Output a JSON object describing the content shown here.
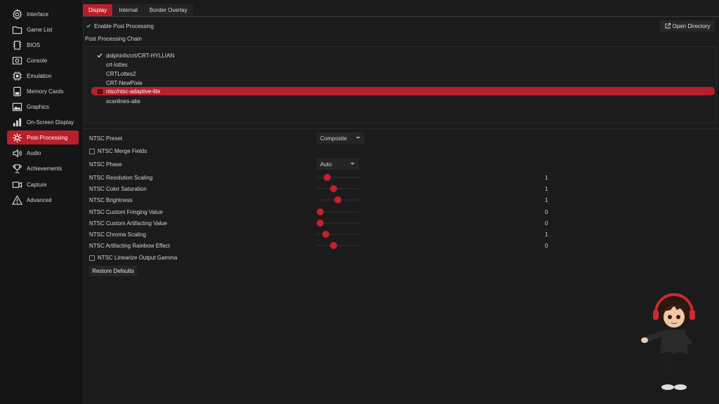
{
  "sidebar": {
    "items": [
      {
        "label": "Interface",
        "icon": "gear-icon"
      },
      {
        "label": "Game List",
        "icon": "folder-icon"
      },
      {
        "label": "BIOS",
        "icon": "chip-icon"
      },
      {
        "label": "Console",
        "icon": "console-icon"
      },
      {
        "label": "Emulation",
        "icon": "cpu-icon"
      },
      {
        "label": "Memory Cards",
        "icon": "memory-card-icon"
      },
      {
        "label": "Graphics",
        "icon": "image-icon"
      },
      {
        "label": "On-Screen Display",
        "icon": "bar-chart-icon"
      },
      {
        "label": "Post-Processing",
        "icon": "sparkle-icon"
      },
      {
        "label": "Audio",
        "icon": "speaker-icon"
      },
      {
        "label": "Achievements",
        "icon": "trophy-icon"
      },
      {
        "label": "Capture",
        "icon": "video-icon"
      },
      {
        "label": "Advanced",
        "icon": "warning-icon"
      }
    ],
    "active_index": 8
  },
  "tabs": [
    {
      "label": "Display",
      "active": true
    },
    {
      "label": "Internal",
      "active": false
    },
    {
      "label": "Border Overlay",
      "active": false
    }
  ],
  "enable_post_processing": {
    "label": "Enable Post Processing",
    "checked": true
  },
  "chain": {
    "title": "Post Processing Chain",
    "open_directory_label": "Open Directory",
    "items": [
      {
        "label": "dolphinfx/crt/CRT-HYLLIAN",
        "checked": true
      },
      {
        "label": "crt-lottes",
        "checked": false
      },
      {
        "label": "CRTLottes2",
        "checked": false
      },
      {
        "label": "CRT-NewPixie",
        "checked": false
      },
      {
        "label": "ntsc/ntsc-adaptive-lite",
        "checked": false,
        "selected": true
      },
      {
        "label": "scanlines-abs",
        "checked": false
      }
    ]
  },
  "options": {
    "preset": {
      "label": "NTSC Preset",
      "value": "Composite"
    },
    "merge_fields": {
      "label": "NTSC Merge Fields",
      "checked": false
    },
    "phase": {
      "label": "NTSC Phase",
      "value": "Auto"
    },
    "sliders": [
      {
        "label": "NTSC Resolution Scaling",
        "value_text": "1",
        "fraction": 0.2
      },
      {
        "label": "NTSC Color Saturation",
        "value_text": "1",
        "fraction": 0.37
      },
      {
        "label": "NTSC Brightness",
        "value_text": "1",
        "fraction": 0.5
      },
      {
        "label": "NTSC Custom Fringing Value",
        "value_text": "0",
        "fraction": 0.0
      },
      {
        "label": "NTSC Custom Artifacting Value",
        "value_text": "0",
        "fraction": 0.0
      },
      {
        "label": "NTSC Chroma Scaling",
        "value_text": "1",
        "fraction": 0.15
      },
      {
        "label": "NTSC Artifacting Rainbow Effect",
        "value_text": "0",
        "fraction": 0.37
      }
    ],
    "linearize": {
      "label": "NTSC Linearize Output Gamma",
      "checked": false
    },
    "restore_label": "Restore Defaults"
  },
  "colors": {
    "accent": "#b81f2b",
    "background": "#1b1b1b",
    "sidebar": "#151515"
  }
}
